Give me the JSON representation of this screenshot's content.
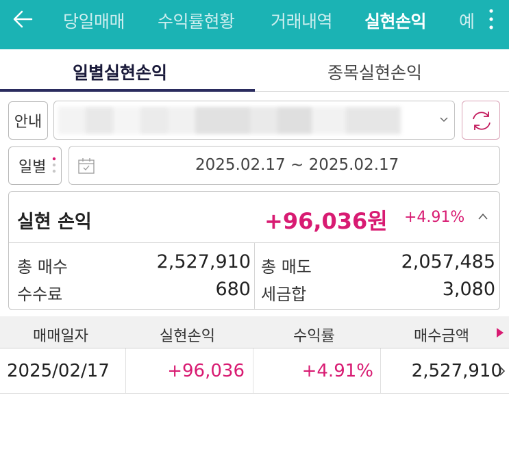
{
  "header": {
    "tabs": [
      "당일매매",
      "수익률현황",
      "거래내역",
      "실현손익",
      "예"
    ],
    "active_tab": "실현손익",
    "bg_color": "#1bb3b4"
  },
  "subtabs": [
    "일별실현손익",
    "종목실현손익"
  ],
  "account": {
    "guide_label": "안내"
  },
  "period": {
    "mode_label": "일별",
    "date_range": "2025.02.17 ~ 2025.02.17"
  },
  "summary": {
    "title": "실현 손익",
    "amount": "+96,036원",
    "rate": "+4.91%",
    "total_buy_label": "총 매수",
    "total_buy": "2,527,910",
    "total_sell_label": "총 매도",
    "total_sell": "2,057,485",
    "fee_label": "수수료",
    "fee": "680",
    "tax_label": "세금합",
    "tax": "3,080"
  },
  "table": {
    "columns": [
      "매매일자",
      "실현손익",
      "수익률",
      "매수금액"
    ],
    "rows": [
      {
        "date": "2025/02/17",
        "profit": "+96,036",
        "rate": "+4.91%",
        "buy_amount": "2,527,910"
      }
    ]
  },
  "colors": {
    "accent_pink": "#d81b72",
    "navy": "#2a2b5e",
    "teal": "#1bb3b4"
  },
  "icons": [
    "back-arrow-icon",
    "more-vertical-icon",
    "chevron-down-icon",
    "refresh-icon",
    "calendar-icon",
    "chevron-up-icon",
    "triangle-right-icon",
    "chevron-right-icon"
  ]
}
